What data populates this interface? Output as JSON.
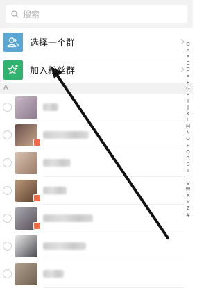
{
  "search": {
    "placeholder": "搜索"
  },
  "entries": [
    {
      "label": "选择一个群",
      "icon": "group-icon",
      "color": "#5aa7d6"
    },
    {
      "label": "加入粉丝群",
      "icon": "star-add-icon",
      "color": "#2fb36f"
    }
  ],
  "section": {
    "letter": "A"
  },
  "contacts": [
    {
      "name": "",
      "badge": false,
      "avatar_colors": [
        "#c9b8c4",
        "#8a7a8e"
      ],
      "name_width": 22
    },
    {
      "name": "",
      "badge": true,
      "avatar_colors": [
        "#6b5048",
        "#c7a890"
      ],
      "name_width": 66
    },
    {
      "name": "",
      "badge": false,
      "avatar_colors": [
        "#d8c2b0",
        "#9a7a68"
      ],
      "name_width": 40
    },
    {
      "name": "",
      "badge": true,
      "avatar_colors": [
        "#b89878",
        "#5e4030"
      ],
      "name_width": 34
    },
    {
      "name": "",
      "badge": true,
      "avatar_colors": [
        "#a8a8b0",
        "#584e58"
      ],
      "name_width": 72
    },
    {
      "name": "",
      "badge": false,
      "avatar_colors": [
        "#e8e8e8",
        "#4a4a50"
      ],
      "name_width": 62
    },
    {
      "name": "",
      "badge": false,
      "avatar_colors": [
        "#b0a090",
        "#706050"
      ],
      "name_width": 30
    }
  ],
  "index": [
    "Q",
    "A",
    "B",
    "C",
    "D",
    "E",
    "F",
    "G",
    "H",
    "I",
    "J",
    "K",
    "L",
    "M",
    "N",
    "O",
    "P",
    "Q",
    "R",
    "S",
    "T",
    "U",
    "V",
    "W",
    "X",
    "Y",
    "Z",
    "#"
  ],
  "colors": {
    "accent_blue": "#5aa7d6",
    "accent_green": "#2fb36f",
    "badge": "#f06b4a",
    "annotation_arrow": "#111111"
  }
}
